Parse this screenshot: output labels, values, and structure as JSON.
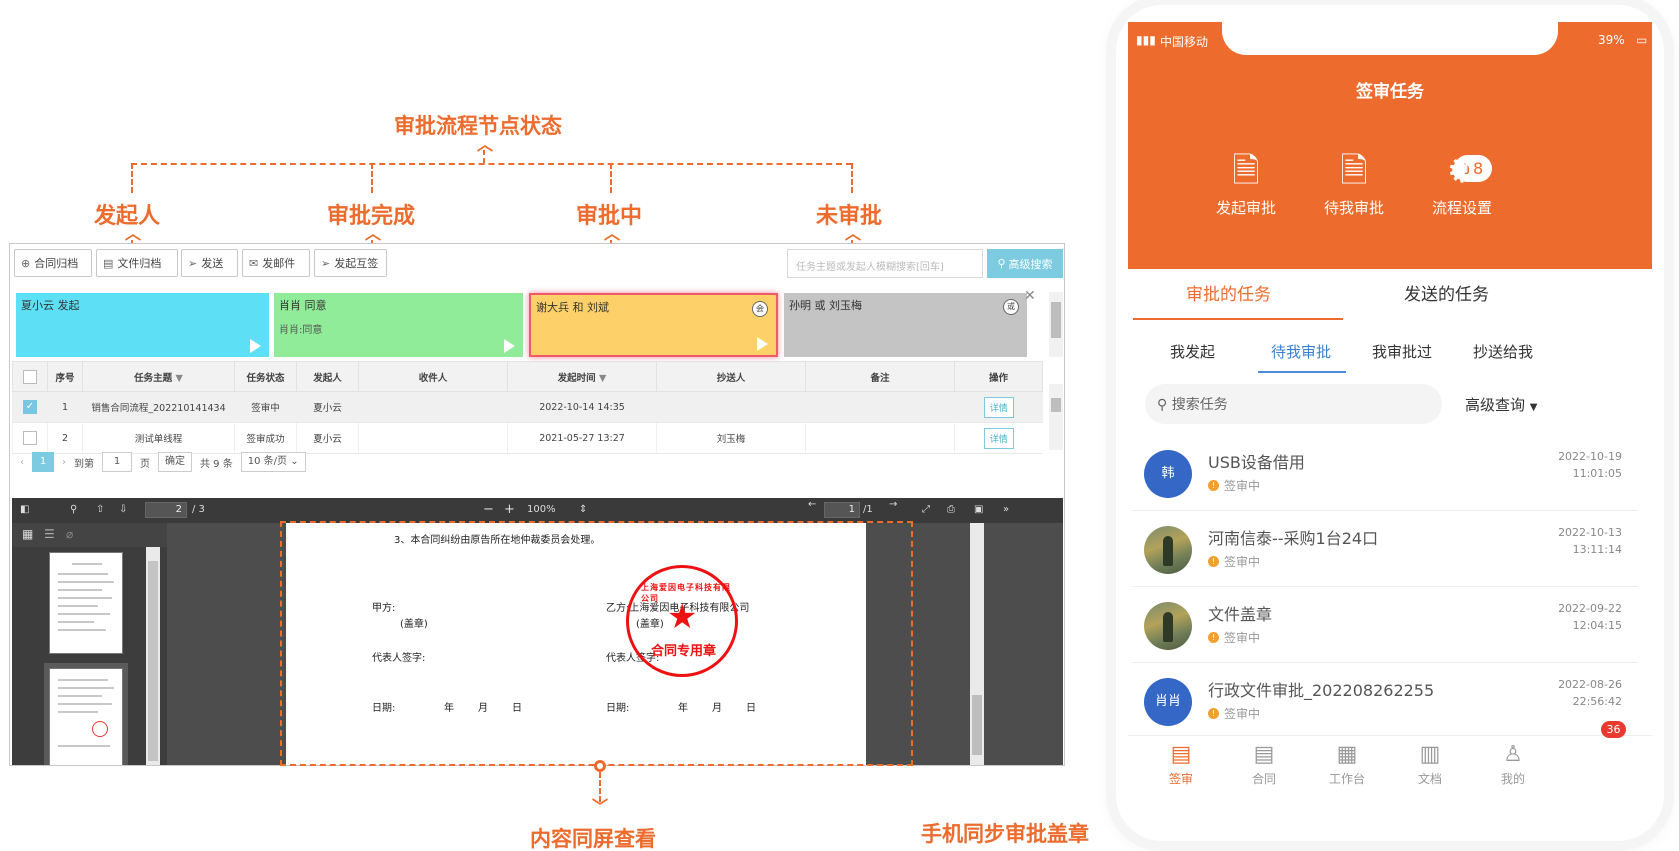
{
  "annotations": {
    "top": "审批流程节点状态",
    "initiator": "发起人",
    "done": "审批完成",
    "in_progress": "审批中",
    "not_started": "未审批",
    "same_screen": "内容同屏查看",
    "mobile_sync": "手机同步审批盖章"
  },
  "colors": {
    "accent": "#ec6b2d",
    "flow_initiator": "#5de0f6",
    "flow_done": "#90ec98",
    "flow_in_progress": "#fdd06a",
    "flow_pending": "#c4c4c4",
    "blue_button": "#7ccbe0"
  },
  "toolbar": {
    "buttons": [
      {
        "label": "合同归档",
        "icon": "plus-circle-icon"
      },
      {
        "label": "文件归档",
        "icon": "document-icon"
      },
      {
        "label": "发送",
        "icon": "send-icon"
      },
      {
        "label": "发邮件",
        "icon": "mail-icon"
      },
      {
        "label": "发起互签",
        "icon": "send-icon"
      }
    ],
    "search_placeholder": "任务主题或发起人模糊搜索[回车]",
    "search_button": "高级搜索"
  },
  "flow": {
    "nodes": [
      {
        "title": "夏小云 发起",
        "sub": ""
      },
      {
        "title": "肖肖 同意",
        "sub": "肖肖:同意"
      },
      {
        "title": "谢大兵 和 刘斌",
        "sub": "",
        "badge": "会"
      },
      {
        "title": "孙明 或 刘玉梅",
        "sub": "",
        "badge": "或"
      }
    ]
  },
  "table": {
    "columns": [
      "序号",
      "任务主题",
      "任务状态",
      "发起人",
      "收件人",
      "发起时间",
      "抄送人",
      "备注",
      "操作"
    ],
    "rows": [
      {
        "no": "1",
        "subject": "销售合同流程_202210141434",
        "status": "签审中",
        "initiator": "夏小云",
        "recipient": "",
        "time": "2022-10-14 14:35",
        "cc": "",
        "note": "",
        "action": "详情",
        "checked": true
      },
      {
        "no": "2",
        "subject": "测试单线程",
        "status": "签审成功",
        "initiator": "夏小云",
        "recipient": "",
        "time": "2021-05-27 13:27",
        "cc": "刘玉梅",
        "note": "",
        "action": "详情",
        "checked": false
      }
    ]
  },
  "pager": {
    "current": "1",
    "goto_prefix": "到第",
    "goto_value": "1",
    "goto_suffix": "页",
    "confirm": "确定",
    "total": "共 9 条",
    "page_size": "10 条/页"
  },
  "pdf": {
    "page_input": "2",
    "page_total": "/ 3",
    "zoom": "100%",
    "right_page_input": "1",
    "right_page_total": "/1",
    "lines": {
      "clause": "3、本合同纠纷由原告所在地仲裁委员会处理。",
      "party_a": "甲方:",
      "seal_a": "(盖章)",
      "party_b": "乙方:上海爱因电子科技有限公司",
      "seal_b": "(盖章)",
      "rep_a": "代表人签字:",
      "rep_b": "代表人签字:",
      "date_a": "日期:",
      "date_b": "日期:",
      "year": "年",
      "month": "月",
      "day": "日"
    },
    "seal_top": "上海爱因电子科技有限公司",
    "seal_bottom": "合同专用章"
  },
  "phone": {
    "carrier": "中国移动",
    "battery": "39%",
    "title": "签审任务",
    "actions": [
      {
        "label": "发起审批",
        "icon": "document-user-icon"
      },
      {
        "label": "待我审批",
        "icon": "document-hourglass-icon",
        "badge": "18"
      },
      {
        "label": "流程设置",
        "icon": "flow-settings-icon"
      }
    ],
    "tabs": [
      "审批的任务",
      "发送的任务"
    ],
    "subtabs": [
      "我发起",
      "待我审批",
      "我审批过",
      "抄送给我"
    ],
    "search_placeholder": "搜索任务",
    "advanced": "高级查询",
    "tasks": [
      {
        "avatar": "韩",
        "name": "USB设备借用",
        "status": "签审中",
        "date": "2022-10-19",
        "time": "11:01:05"
      },
      {
        "avatar": "",
        "name": "河南信泰--采购1台24口",
        "status": "签审中",
        "date": "2022-10-13",
        "time": "13:11:14"
      },
      {
        "avatar": "",
        "name": "文件盖章",
        "status": "签审中",
        "date": "2022-09-22",
        "time": "12:04:15"
      },
      {
        "avatar": "肖肖",
        "name": "行政文件审批_202208262255",
        "status": "签审中",
        "date": "2022-08-26",
        "time": "22:56:42"
      }
    ],
    "nav": [
      {
        "label": "签审",
        "icon": "stamp-icon"
      },
      {
        "label": "合同",
        "icon": "contract-icon"
      },
      {
        "label": "工作台",
        "icon": "grid-icon"
      },
      {
        "label": "文档",
        "icon": "doc-icon"
      },
      {
        "label": "我的",
        "icon": "user-icon"
      }
    ],
    "nav_badge": "36"
  }
}
